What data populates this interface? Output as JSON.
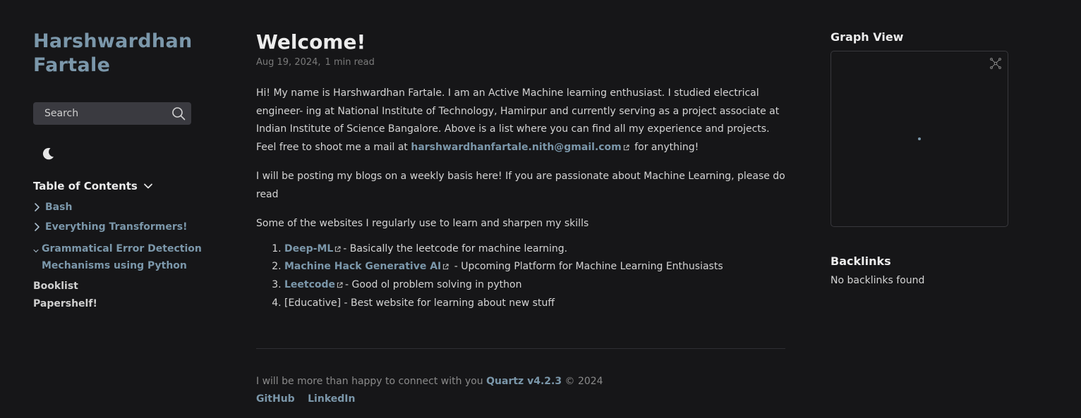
{
  "site": {
    "title_line1": "Harshwardhan",
    "title_line2": "Fartale"
  },
  "search": {
    "label": "Search"
  },
  "toc": {
    "header": "Table of Contents",
    "items": [
      {
        "label": "Bash"
      },
      {
        "label": "Everything Transformers!"
      },
      {
        "label_line1": "Grammatical Error Detection",
        "label_line2": "Mechanisms using Python"
      }
    ],
    "plain": [
      {
        "label": "Booklist"
      },
      {
        "label": "Papershelf!"
      }
    ]
  },
  "article": {
    "title": "Welcome!",
    "date": "Aug 19, 2024,",
    "read_time": "1 min read",
    "p1_pre": "Hi! My name is Harshwardhan Fartale. I am an Active Machine learning enthusiast. I studied electrical engineer- ing at National Institute of Technology, Hamirpur and currently serving as a project associate at Indian Institute of Science Bangalore. Above is a list where you can find all my experience and projects. Feel free to shoot me a mail at ",
    "p1_email": "harshwardhanfartale.nith@gmail.com",
    "p1_post": " for anything!",
    "p2": "I will be posting my blogs on a weekly basis here! If you are passionate about Machine Learning, please do read",
    "p3": "Some of the websites I regularly use to learn and sharpen my skills",
    "list": [
      {
        "link": "Deep-ML",
        "text": "- Basically the leetcode for machine learning."
      },
      {
        "link": "Machine Hack Generative AI",
        "text": " - Upcoming Platform for Machine Learning Enthusiasts"
      },
      {
        "link": "Leetcode",
        "text": "- Good ol problem solving in python"
      },
      {
        "text": "[Educative] - Best website for learning about new stuff"
      }
    ]
  },
  "footer": {
    "text": "I will be more than happy to connect with you ",
    "quartz": "Quartz v4.2.3",
    "copyright": " © 2024",
    "links": [
      "GitHub",
      "LinkedIn"
    ]
  },
  "graph": {
    "title": "Graph View"
  },
  "backlinks": {
    "title": "Backlinks",
    "empty": "No backlinks found"
  },
  "colors": {
    "background": "#161618",
    "accent": "#7b97aa",
    "text": "#d4d4d4"
  }
}
